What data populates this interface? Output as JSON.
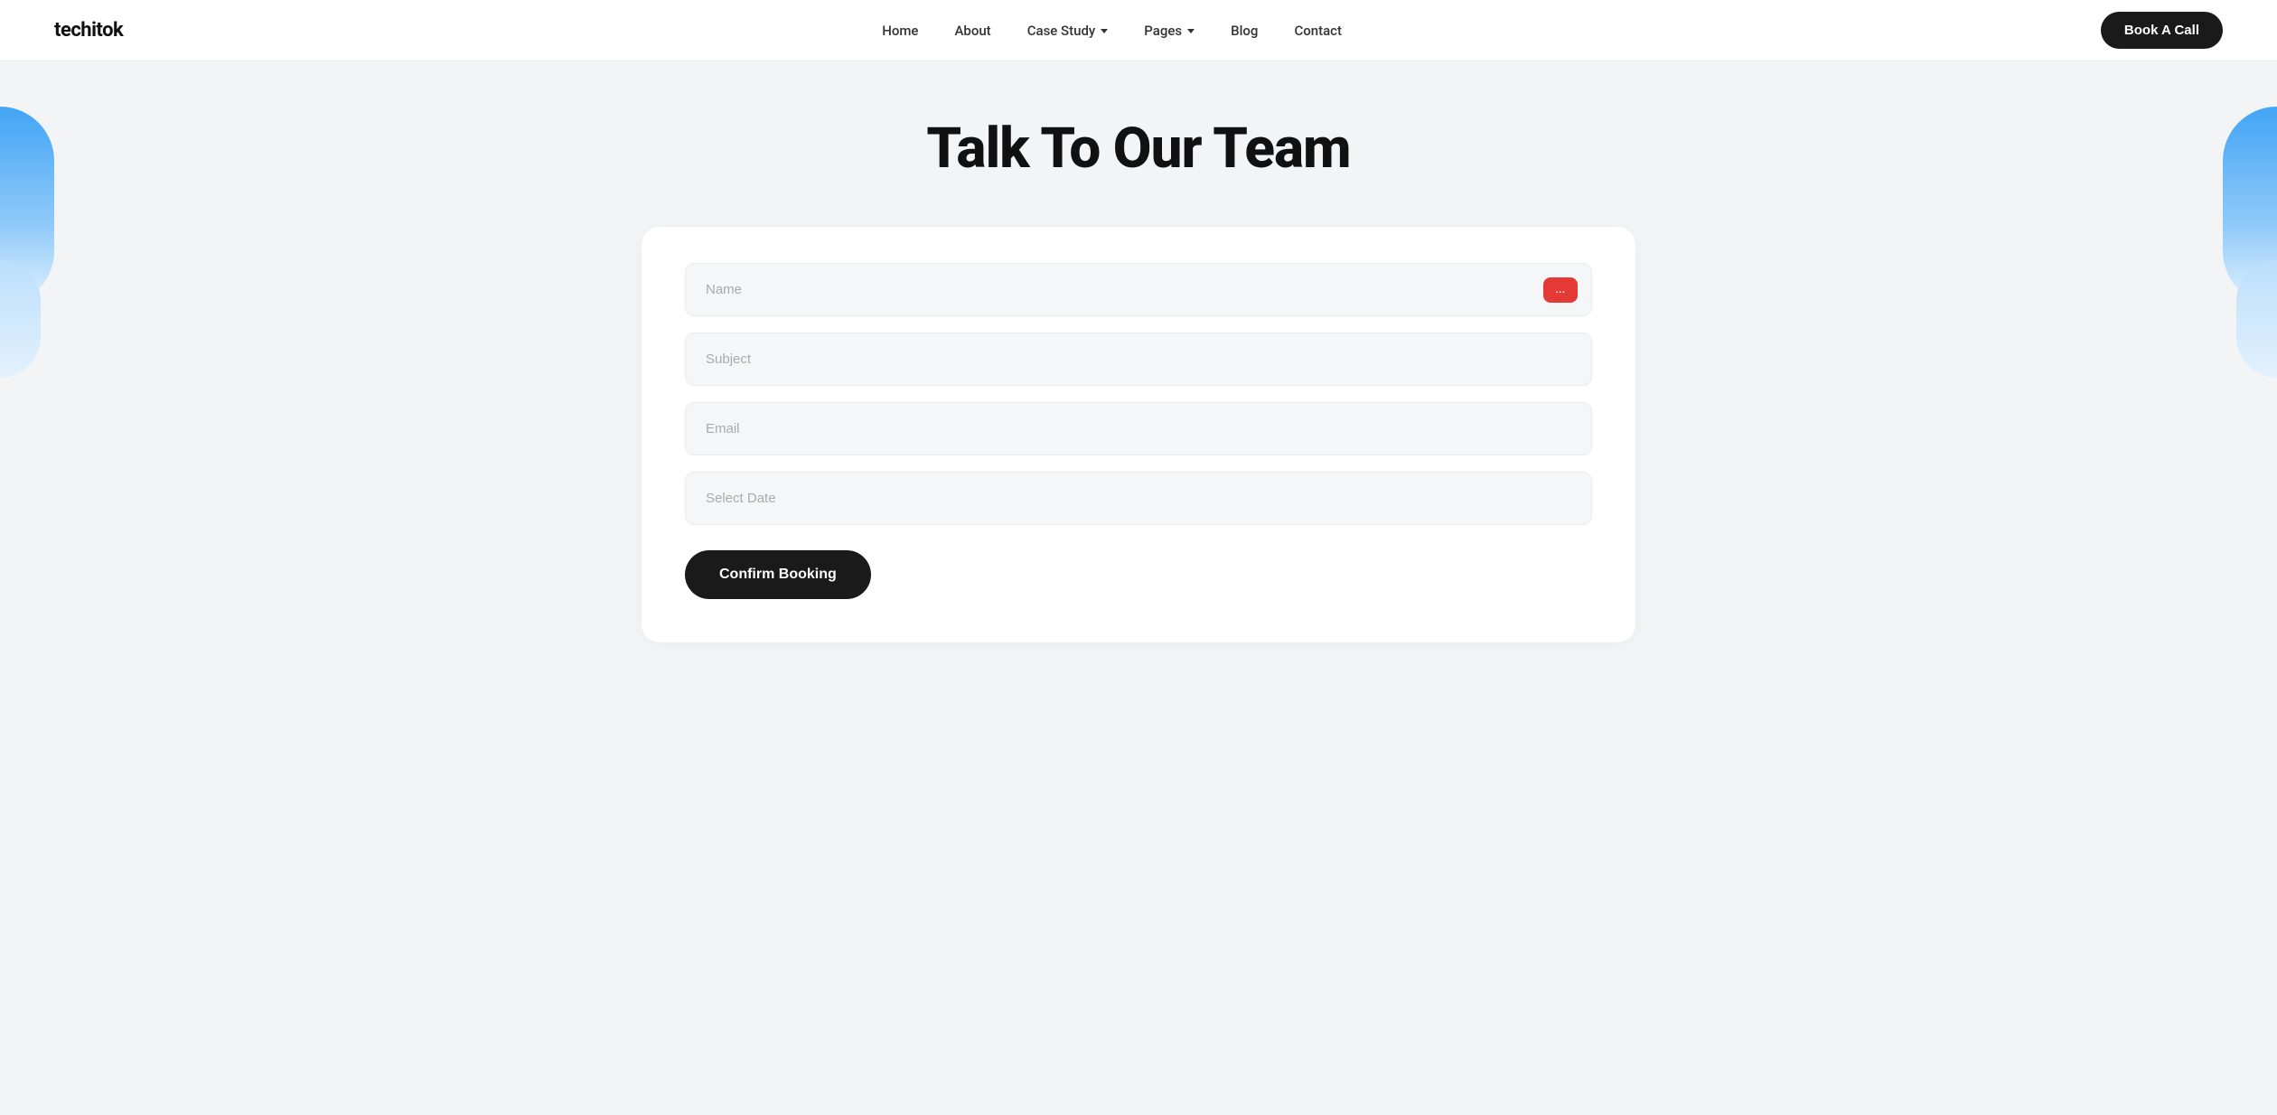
{
  "navbar": {
    "logo": "techitok",
    "links": [
      {
        "label": "Home",
        "has_dropdown": false
      },
      {
        "label": "About",
        "has_dropdown": false
      },
      {
        "label": "Case Study",
        "has_dropdown": true
      },
      {
        "label": "Pages",
        "has_dropdown": true
      },
      {
        "label": "Blog",
        "has_dropdown": false
      },
      {
        "label": "Contact",
        "has_dropdown": false
      }
    ],
    "book_call_label": "Book A Call"
  },
  "main": {
    "page_title": "Talk To Our Team",
    "form": {
      "name_placeholder": "Name",
      "subject_placeholder": "Subject",
      "email_placeholder": "Email",
      "date_placeholder": "Select Date",
      "confirm_button_label": "Confirm Booking",
      "ai_icon_label": "..."
    }
  }
}
